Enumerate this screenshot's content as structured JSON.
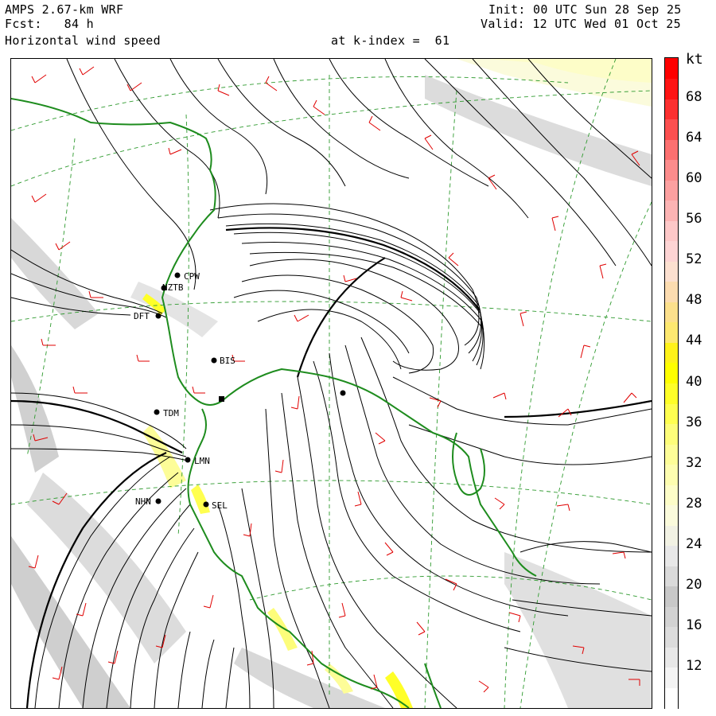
{
  "header": {
    "model": "AMPS 2.67-km WRF",
    "forecast": "Fcst:   84 h",
    "field": "Horizontal wind speed",
    "init": "Init: 00 UTC Sun 28 Sep 25",
    "valid": "Valid: 12 UTC Wed 01 Oct 25",
    "level": "at k-index =  61"
  },
  "colorbar": {
    "unit": "kt",
    "labels": [
      "68",
      "64",
      "60",
      "56",
      "52",
      "48",
      "44",
      "40",
      "36",
      "32",
      "28",
      "24",
      "20",
      "16",
      "12"
    ],
    "bins": [
      {
        "min": 8,
        "max": 10,
        "color": "#ffffff"
      },
      {
        "min": 10,
        "max": 12,
        "color": "#f4f4f4"
      },
      {
        "min": 12,
        "max": 14,
        "color": "#e8e8e8"
      },
      {
        "min": 14,
        "max": 16,
        "color": "#dcdcdc"
      },
      {
        "min": 16,
        "max": 18,
        "color": "#d2d2d2"
      },
      {
        "min": 18,
        "max": 20,
        "color": "#c8c8c8"
      },
      {
        "min": 20,
        "max": 22,
        "color": "#dadada"
      },
      {
        "min": 22,
        "max": 24,
        "color": "#e8e8e8"
      },
      {
        "min": 24,
        "max": 26,
        "color": "#f2f2e4"
      },
      {
        "min": 26,
        "max": 28,
        "color": "#fbfbdc"
      },
      {
        "min": 28,
        "max": 30,
        "color": "#fdfdc8"
      },
      {
        "min": 30,
        "max": 32,
        "color": "#fdfdb0"
      },
      {
        "min": 32,
        "max": 34,
        "color": "#fdfd98"
      },
      {
        "min": 34,
        "max": 36,
        "color": "#fdfd7a"
      },
      {
        "min": 36,
        "max": 38,
        "color": "#ffff50"
      },
      {
        "min": 38,
        "max": 40,
        "color": "#ffff28"
      },
      {
        "min": 40,
        "max": 42,
        "color": "#ffff00"
      },
      {
        "min": 42,
        "max": 44,
        "color": "#fff21a"
      },
      {
        "min": 44,
        "max": 46,
        "color": "#fde870"
      },
      {
        "min": 46,
        "max": 48,
        "color": "#fce08c"
      },
      {
        "min": 48,
        "max": 50,
        "color": "#fcdcb0"
      },
      {
        "min": 50,
        "max": 52,
        "color": "#fce0d0"
      },
      {
        "min": 52,
        "max": 54,
        "color": "#fdd4d4"
      },
      {
        "min": 54,
        "max": 56,
        "color": "#fdc8c8"
      },
      {
        "min": 56,
        "max": 58,
        "color": "#fcb4b4"
      },
      {
        "min": 58,
        "max": 60,
        "color": "#fca0a0"
      },
      {
        "min": 60,
        "max": 62,
        "color": "#fc8c8c"
      },
      {
        "min": 62,
        "max": 64,
        "color": "#fc7070"
      },
      {
        "min": 64,
        "max": 66,
        "color": "#fc5050"
      },
      {
        "min": 66,
        "max": 68,
        "color": "#fc3030"
      },
      {
        "min": 68,
        "max": 70,
        "color": "#ff1414"
      },
      {
        "min": 70,
        "max": 72,
        "color": "#ff0000"
      }
    ]
  },
  "stations": [
    "CPW",
    "NZTB",
    "DFT",
    "BIS",
    "TDM",
    "LMN",
    "NHN",
    "SEL"
  ],
  "colors": {
    "coastline": "#1e8c1e",
    "graticule": "#2e9a2e",
    "streamline": "#000000",
    "barb": "#e00000",
    "station": "#000000"
  },
  "icons": {
    "station_marker": "filled-circle",
    "wind_barb": "red-wind-barb"
  }
}
